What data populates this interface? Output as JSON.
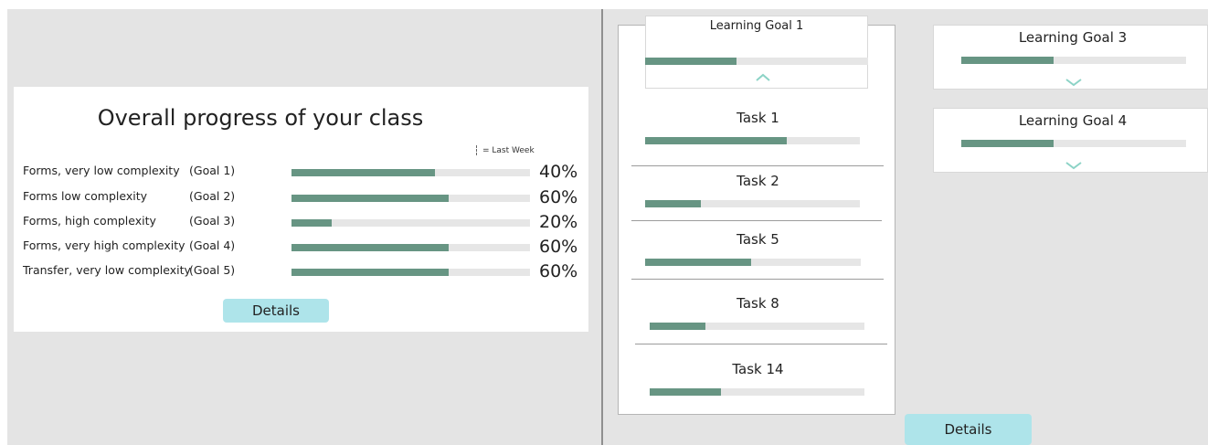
{
  "colors": {
    "panel_bg": "#e4e4e4",
    "bar_fill": "#679583",
    "bar_track": "#e6e6e6",
    "button_bg": "#aee4ea",
    "chevron": "#8cd3c6"
  },
  "overall": {
    "title": "Overall progress of your class",
    "legend_label": "= Last Week",
    "goals": [
      {
        "name": "Forms, very low complexity",
        "tag": "(Goal 1)",
        "percent_label": "40%",
        "fill": 0.6
      },
      {
        "name": "Forms low complexity",
        "tag": "(Goal 2)",
        "percent_label": "60%",
        "fill": 0.66
      },
      {
        "name": "Forms, high complexity",
        "tag": "(Goal 3)",
        "percent_label": "20%",
        "fill": 0.17
      },
      {
        "name": "Forms, very high complexity",
        "tag": "(Goal 4)",
        "percent_label": "60%",
        "fill": 0.66
      },
      {
        "name": "Transfer, very low complexity",
        "tag": "(Goal 5)",
        "percent_label": "60%",
        "fill": 0.66
      }
    ],
    "details_label": "Details"
  },
  "goal_detail": {
    "title": "Learning Goal 1",
    "fill": 0.41,
    "tasks": [
      {
        "title": "Task 1",
        "fill": 0.66
      },
      {
        "title": "Task 2",
        "fill": 0.26
      },
      {
        "title": "Task 5",
        "fill": 0.49
      },
      {
        "title": "Task 8",
        "fill": 0.26
      },
      {
        "title": "Task 14",
        "fill": 0.33
      }
    ],
    "details_label": "Details"
  },
  "other_goals": [
    {
      "title": "Learning Goal 3",
      "fill": 0.41
    },
    {
      "title": "Learning Goal 4",
      "fill": 0.41
    }
  ]
}
